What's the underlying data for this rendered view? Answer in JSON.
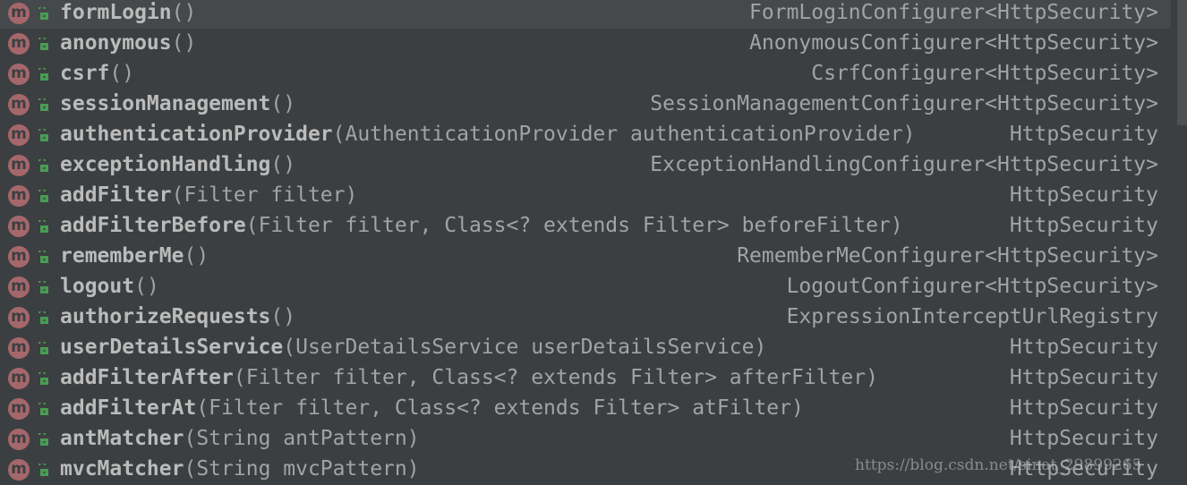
{
  "popup": {
    "selected_index": 0,
    "colors": {
      "background": "#3c3f41",
      "selected": "#46494b",
      "method_icon": "#a5676b",
      "lock_icon": "#499c54"
    },
    "items": [
      {
        "name": "formLogin",
        "params": "()",
        "type": "FormLoginConfigurer<HttpSecurity>"
      },
      {
        "name": "anonymous",
        "params": "()",
        "type": "AnonymousConfigurer<HttpSecurity>"
      },
      {
        "name": "csrf",
        "params": "()",
        "type": "CsrfConfigurer<HttpSecurity>"
      },
      {
        "name": "sessionManagement",
        "params": "()",
        "type": "SessionManagementConfigurer<HttpSecurity>"
      },
      {
        "name": "authenticationProvider",
        "params": "(AuthenticationProvider authenticationProvider)",
        "type": "HttpSecurity"
      },
      {
        "name": "exceptionHandling",
        "params": "()",
        "type": "ExceptionHandlingConfigurer<HttpSecurity>"
      },
      {
        "name": "addFilter",
        "params": "(Filter filter)",
        "type": "HttpSecurity"
      },
      {
        "name": "addFilterBefore",
        "params": "(Filter filter, Class<? extends Filter> beforeFilter)",
        "type": "HttpSecurity"
      },
      {
        "name": "rememberMe",
        "params": "()",
        "type": "RememberMeConfigurer<HttpSecurity>"
      },
      {
        "name": "logout",
        "params": "()",
        "type": "LogoutConfigurer<HttpSecurity>"
      },
      {
        "name": "authorizeRequests",
        "params": "()",
        "type": "ExpressionInterceptUrlRegistry"
      },
      {
        "name": "userDetailsService",
        "params": "(UserDetailsService userDetailsService)",
        "type": "HttpSecurity"
      },
      {
        "name": "addFilterAfter",
        "params": "(Filter filter, Class<? extends Filter> afterFilter)",
        "type": "HttpSecurity"
      },
      {
        "name": "addFilterAt",
        "params": "(Filter filter, Class<? extends Filter> atFilter)",
        "type": "HttpSecurity"
      },
      {
        "name": "antMatcher",
        "params": "(String antPattern)",
        "type": "HttpSecurity"
      },
      {
        "name": "mvcMatcher",
        "params": "(String mvcPattern)",
        "type": "HttpSecurity"
      }
    ],
    "icon_letter": "m"
  },
  "watermark": "https://blog.csdn.net/sinat_29899265"
}
